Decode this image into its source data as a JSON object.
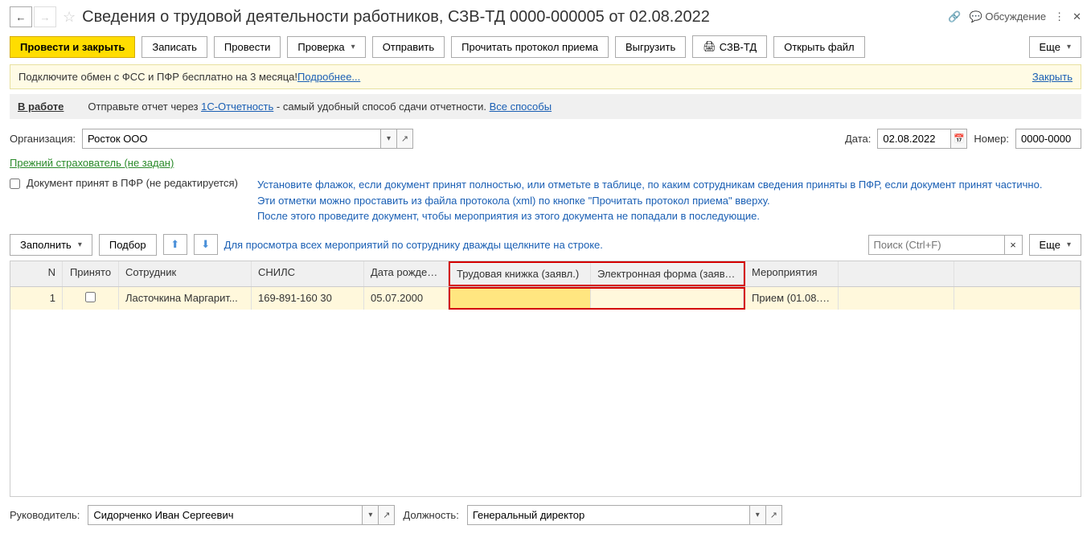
{
  "title": "Сведения о трудовой деятельности работников, СЗВ-ТД 0000-000005 от 02.08.2022",
  "discuss": "Обсуждение",
  "toolbar": {
    "post_close": "Провести и закрыть",
    "save": "Записать",
    "post": "Провести",
    "check": "Проверка",
    "send": "Отправить",
    "read_proto": "Прочитать протокол приема",
    "upload": "Выгрузить",
    "szv": "СЗВ-ТД",
    "open_file": "Открыть файл",
    "more": "Еще"
  },
  "promo": {
    "text": "Подключите обмен с ФСС и ПФР бесплатно на 3 месяца! ",
    "link": "Подробнее...",
    "close": "Закрыть"
  },
  "status": {
    "label": "В работе",
    "text": "Отправьте отчет через ",
    "link1": "1С-Отчетность",
    "text2": " - самый удобный способ сдачи отчетности. ",
    "link2": "Все способы"
  },
  "org": {
    "label": "Организация:",
    "value": "Росток ООО"
  },
  "date": {
    "label": "Дата:",
    "value": "02.08.2022"
  },
  "number": {
    "label": "Номер:",
    "value": "0000-0000"
  },
  "prev_insurer": "Прежний страхователь (не задан)",
  "accepted_check": "Документ принят в ПФР (не редактируется)",
  "hint": {
    "l1": "Установите флажок, если документ принят полностью, или отметьте в таблице, по каким сотрудникам сведения приняты в ПФР, если документ принят частично.",
    "l2": "Эти отметки можно проставить из файла протокола (xml) по кнопке \"Прочитать протокол приема\" вверху.",
    "l3": "После этого проведите документ, чтобы мероприятия из этого документа не попадали в последующие."
  },
  "table_toolbar": {
    "fill": "Заполнить",
    "select": "Подбор",
    "hint": "Для просмотра всех мероприятий по сотруднику дважды щелкните на строке.",
    "search_ph": "Поиск (Ctrl+F)",
    "more": "Еще"
  },
  "columns": {
    "n": "N",
    "accepted": "Принято",
    "employee": "Сотрудник",
    "snils": "СНИЛС",
    "birthdate": "Дата рождения",
    "workbook": "Трудовая книжка (заявл.)",
    "eform": "Электронная форма (заявл.)",
    "events": "Мероприятия"
  },
  "rows": [
    {
      "n": "1",
      "employee": "Ласточкина Маргарит...",
      "snils": "169-891-160 30",
      "birthdate": "05.07.2000",
      "workbook": "",
      "eform": "",
      "events": "Прием (01.08.20..."
    }
  ],
  "footer": {
    "leader_label": "Руководитель:",
    "leader_value": "Сидорченко Иван Сергеевич",
    "position_label": "Должность:",
    "position_value": "Генеральный директор"
  }
}
